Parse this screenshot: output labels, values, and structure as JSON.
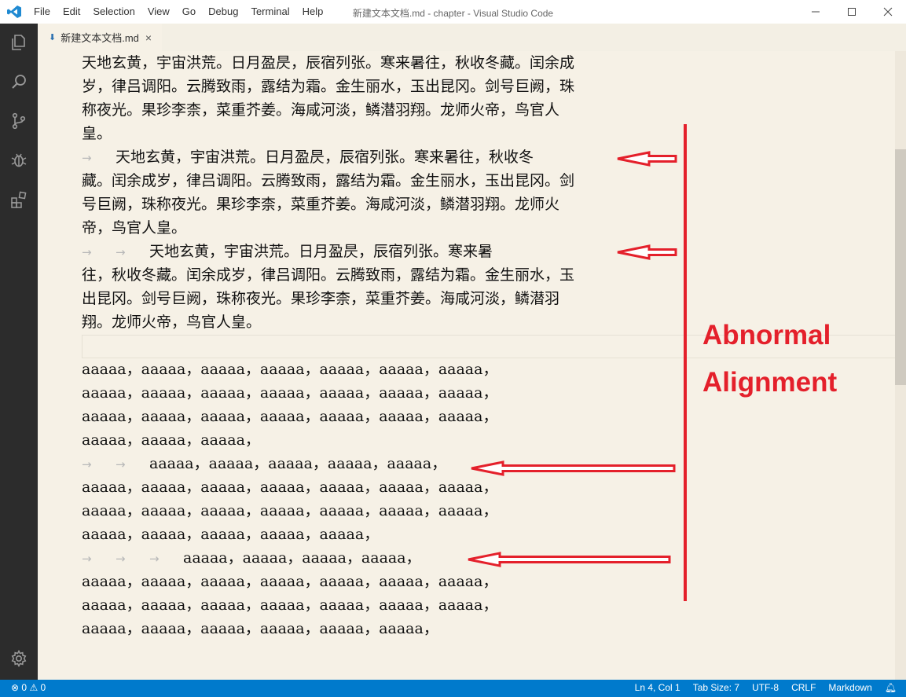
{
  "window": {
    "title": "新建文本文档.md - chapter - Visual Studio Code",
    "menu": [
      "File",
      "Edit",
      "Selection",
      "View",
      "Go",
      "Debug",
      "Terminal",
      "Help"
    ]
  },
  "tab": {
    "label": "新建文本文档.md"
  },
  "editor": {
    "lines": [
      {
        "prefix": "",
        "text": "天地玄黄，宇宙洪荒。日月盈昃，辰宿列张。寒来暑往，秋收冬藏。闰余成"
      },
      {
        "prefix": "",
        "text": "岁，律吕调阳。云腾致雨，露结为霜。金生丽水，玉出昆冈。剑号巨阙，珠"
      },
      {
        "prefix": "",
        "text": "称夜光。果珍李柰，菜重芥姜。海咸河淡，鳞潜羽翔。龙师火帝，鸟官人"
      },
      {
        "prefix": "",
        "text": "皇。"
      },
      {
        "prefix": "→",
        "text": "天地玄黄，宇宙洪荒。日月盈昃，辰宿列张。寒来暑往，秋收冬"
      },
      {
        "prefix": "",
        "text": "藏。闰余成岁，律吕调阳。云腾致雨，露结为霜。金生丽水，玉出昆冈。剑"
      },
      {
        "prefix": "",
        "text": "号巨阙，珠称夜光。果珍李柰，菜重芥姜。海咸河淡，鳞潜羽翔。龙师火"
      },
      {
        "prefix": "",
        "text": "帝，鸟官人皇。"
      },
      {
        "prefix": "→ →",
        "text": "天地玄黄，宇宙洪荒。日月盈昃，辰宿列张。寒来暑"
      },
      {
        "prefix": "",
        "text": "往，秋收冬藏。闰余成岁，律吕调阳。云腾致雨，露结为霜。金生丽水，玉"
      },
      {
        "prefix": "",
        "text": "出昆冈。剑号巨阙，珠称夜光。果珍李柰，菜重芥姜。海咸河淡，鳞潜羽"
      },
      {
        "prefix": "",
        "text": "翔。龙师火帝，鸟官人皇。"
      },
      {
        "prefix": "",
        "text": ""
      },
      {
        "prefix": "",
        "text": "aaaaa，aaaaa，aaaaa，aaaaa，aaaaa，aaaaa，aaaaa，"
      },
      {
        "prefix": "",
        "text": "aaaaa，aaaaa，aaaaa，aaaaa，aaaaa，aaaaa，aaaaa，"
      },
      {
        "prefix": "",
        "text": "aaaaa，aaaaa，aaaaa，aaaaa，aaaaa，aaaaa，aaaaa，"
      },
      {
        "prefix": "",
        "text": "aaaaa，aaaaa，aaaaa，"
      },
      {
        "prefix": "→ →",
        "text": "aaaaa，aaaaa，aaaaa，aaaaa，aaaaa，"
      },
      {
        "prefix": "",
        "text": "aaaaa，aaaaa，aaaaa，aaaaa，aaaaa，aaaaa，aaaaa，"
      },
      {
        "prefix": "",
        "text": "aaaaa，aaaaa，aaaaa，aaaaa，aaaaa，aaaaa，aaaaa，"
      },
      {
        "prefix": "",
        "text": "aaaaa，aaaaa，aaaaa，aaaaa，aaaaa，"
      },
      {
        "prefix": "→ → →",
        "text": "aaaaa，aaaaa，aaaaa，aaaaa，"
      },
      {
        "prefix": "",
        "text": "aaaaa，aaaaa，aaaaa，aaaaa，aaaaa，aaaaa，aaaaa，"
      },
      {
        "prefix": "",
        "text": "aaaaa，aaaaa，aaaaa，aaaaa，aaaaa，aaaaa，aaaaa，"
      },
      {
        "prefix": "",
        "text": "aaaaa，aaaaa，aaaaa，aaaaa，aaaaa，aaaaa，"
      }
    ]
  },
  "statusbar": {
    "errors": "0",
    "warnings": "0",
    "position": "Ln 4, Col 1",
    "tab_size": "Tab Size: 7",
    "encoding": "UTF-8",
    "eol": "CRLF",
    "language": "Markdown"
  },
  "annotation": {
    "line1": "Abnormal",
    "line2": "Alignment",
    "color": "#e4202b"
  }
}
